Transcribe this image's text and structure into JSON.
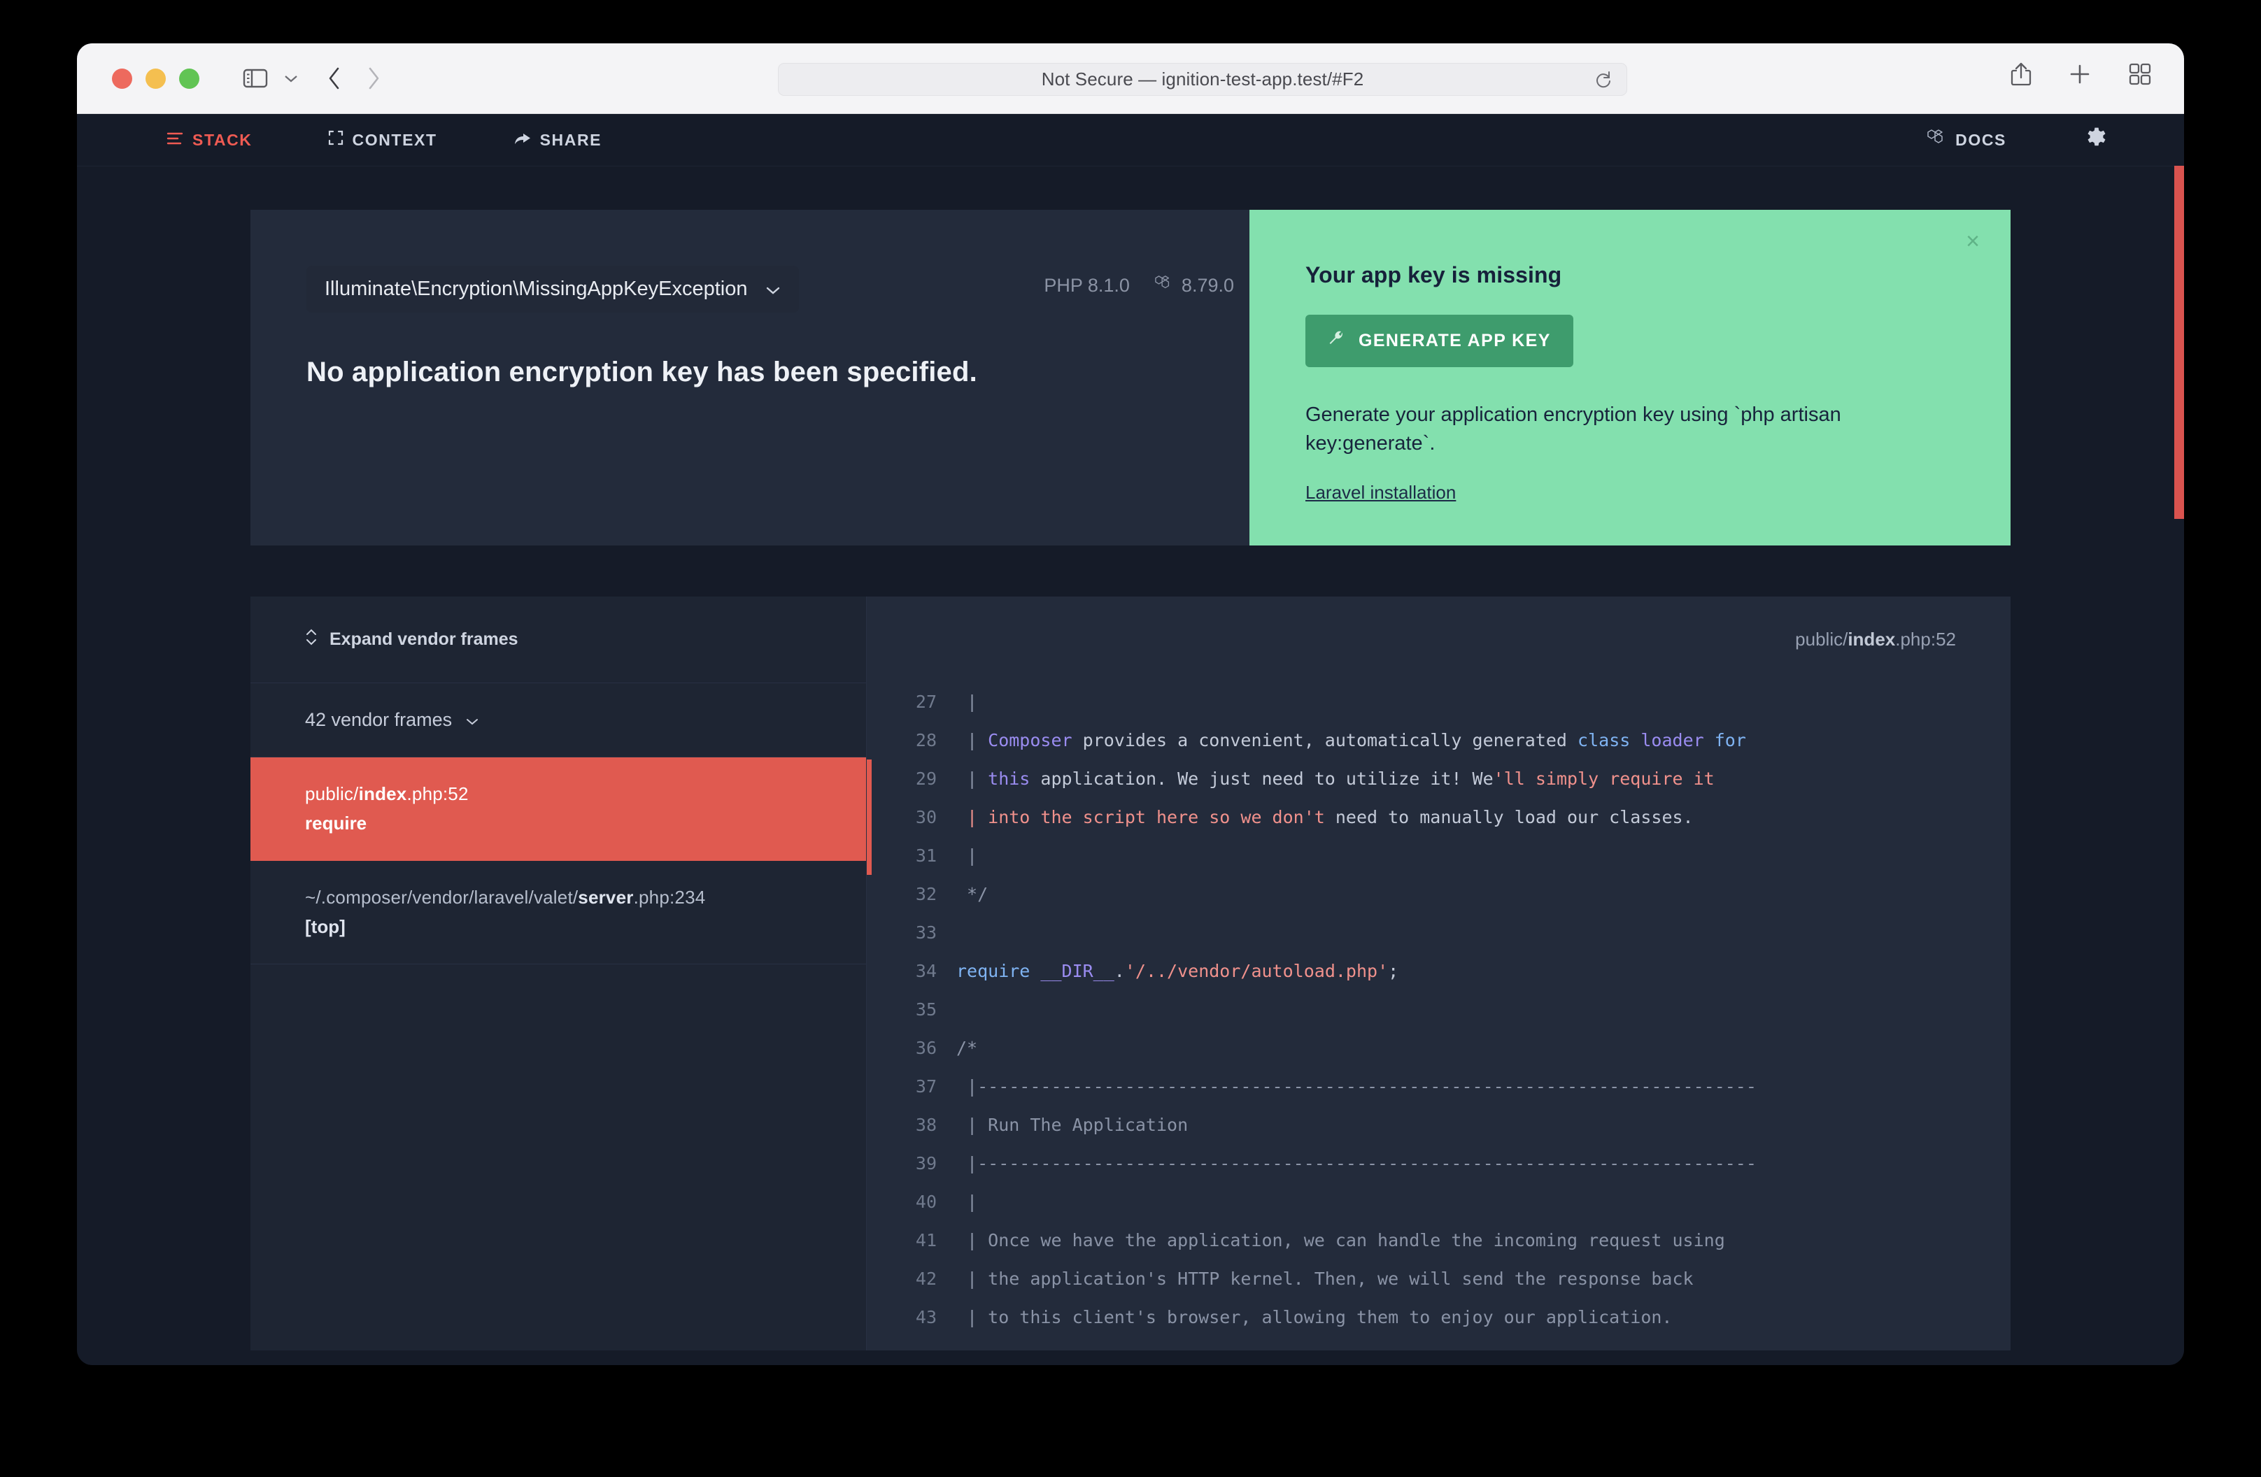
{
  "browser": {
    "address": "Not Secure — ignition-test-app.test/#F2",
    "icons": {
      "sidebar": "sidebar-icon",
      "sidebar_chevron": "chevron-down-icon",
      "back": "back-arrow-icon",
      "forward": "forward-arrow-icon",
      "reload": "reload-icon",
      "share": "share-icon",
      "new_tab": "plus-icon",
      "tab_overview": "grid-icon"
    }
  },
  "nav": {
    "stack": "STACK",
    "context": "CONTEXT",
    "share": "SHARE",
    "docs": "DOCS",
    "settings_icon": "gear-icon",
    "active": "STACK",
    "active_color": "#ef5b53"
  },
  "exception": {
    "class_name": "Illuminate\\Encryption\\MissingAppKeyException",
    "message": "No application encryption key has been specified.",
    "php_version": "PHP 8.1.0",
    "laravel_version": "8.79.0"
  },
  "solution": {
    "title": "Your app key is missing",
    "button_label": "GENERATE APP KEY",
    "button_icon": "wrench-icon",
    "description": "Generate your application encryption key using `php artisan key:generate`.",
    "link_label": "Laravel installation",
    "close_label": "×",
    "background_color": "#83e0ae",
    "button_color": "#3e9c6d"
  },
  "stack": {
    "expand_vendor_label": "Expand vendor frames",
    "vendor_frames_label": "42 vendor frames",
    "frames": [
      {
        "path_prefix": "public/",
        "path_file": "index",
        "path_suffix": ".php:52",
        "callable": "require",
        "active": true
      },
      {
        "path_prefix": "~/.composer/vendor/laravel/valet/",
        "path_file": "server",
        "path_suffix": ".php:234",
        "callable": "[top]",
        "active": false
      }
    ]
  },
  "code": {
    "file_prefix": "public/",
    "file_name": "index",
    "file_suffix": ".php:52",
    "lines": [
      {
        "n": "27",
        "highlight": false,
        "tokens": [
          {
            "t": " | ",
            "c": "tok-comment"
          }
        ]
      },
      {
        "n": "28",
        "highlight": false,
        "tokens": [
          {
            "t": " | ",
            "c": "tok-comment"
          },
          {
            "t": "Composer",
            "c": "tok-class"
          },
          {
            "t": " provides a convenient, automatically generated ",
            "c": "tok-default"
          },
          {
            "t": "class",
            "c": "tok-keyword"
          },
          {
            "t": " ",
            "c": "tok-default"
          },
          {
            "t": "loader",
            "c": "tok-class"
          },
          {
            "t": " ",
            "c": "tok-default"
          },
          {
            "t": "for",
            "c": "tok-keyword"
          }
        ]
      },
      {
        "n": "29",
        "highlight": true,
        "tokens": [
          {
            "t": " | ",
            "c": "tok-comment"
          },
          {
            "t": "this",
            "c": "tok-class"
          },
          {
            "t": " application. We just need to utilize it! We",
            "c": "tok-default"
          },
          {
            "t": "'ll simply require it",
            "c": "tok-string"
          }
        ]
      },
      {
        "n": "30",
        "highlight": true,
        "tokens": [
          {
            "t": " | ",
            "c": "tok-string"
          },
          {
            "t": "into the script here so we don't",
            "c": "tok-string"
          },
          {
            "t": " need to manually load our classes.",
            "c": "tok-default"
          }
        ]
      },
      {
        "n": "31",
        "highlight": true,
        "tokens": [
          {
            "t": " | ",
            "c": "tok-comment"
          }
        ]
      },
      {
        "n": "32",
        "highlight": false,
        "tokens": [
          {
            "t": " */",
            "c": "tok-comment"
          }
        ]
      },
      {
        "n": "33",
        "highlight": false,
        "tokens": [
          {
            "t": "",
            "c": "tok-default"
          }
        ]
      },
      {
        "n": "34",
        "highlight": false,
        "tokens": [
          {
            "t": "require",
            "c": "tok-keyword"
          },
          {
            "t": " ",
            "c": "tok-default"
          },
          {
            "t": "__DIR__",
            "c": "tok-class"
          },
          {
            "t": ".",
            "c": "tok-default"
          },
          {
            "t": "'/../vendor/autoload.php'",
            "c": "tok-string"
          },
          {
            "t": ";",
            "c": "tok-default"
          }
        ]
      },
      {
        "n": "35",
        "highlight": false,
        "tokens": [
          {
            "t": "",
            "c": "tok-default"
          }
        ]
      },
      {
        "n": "36",
        "highlight": false,
        "tokens": [
          {
            "t": "/*",
            "c": "tok-comment"
          }
        ]
      },
      {
        "n": "37",
        "highlight": false,
        "tokens": [
          {
            "t": " |--------------------------------------------------------------------------",
            "c": "tok-comment"
          }
        ]
      },
      {
        "n": "38",
        "highlight": false,
        "tokens": [
          {
            "t": " | Run The Application",
            "c": "tok-comment"
          }
        ]
      },
      {
        "n": "39",
        "highlight": false,
        "tokens": [
          {
            "t": " |--------------------------------------------------------------------------",
            "c": "tok-comment"
          }
        ]
      },
      {
        "n": "40",
        "highlight": false,
        "tokens": [
          {
            "t": " |",
            "c": "tok-comment"
          }
        ]
      },
      {
        "n": "41",
        "highlight": false,
        "tokens": [
          {
            "t": " | Once we have the application, we can handle the incoming request using",
            "c": "tok-comment"
          }
        ]
      },
      {
        "n": "42",
        "highlight": false,
        "tokens": [
          {
            "t": " | the application's HTTP kernel. Then, we will send the response back",
            "c": "tok-comment"
          }
        ]
      },
      {
        "n": "43",
        "highlight": false,
        "tokens": [
          {
            "t": " | to this client's browser, allowing them to enjoy our application.",
            "c": "tok-comment"
          }
        ]
      }
    ]
  }
}
